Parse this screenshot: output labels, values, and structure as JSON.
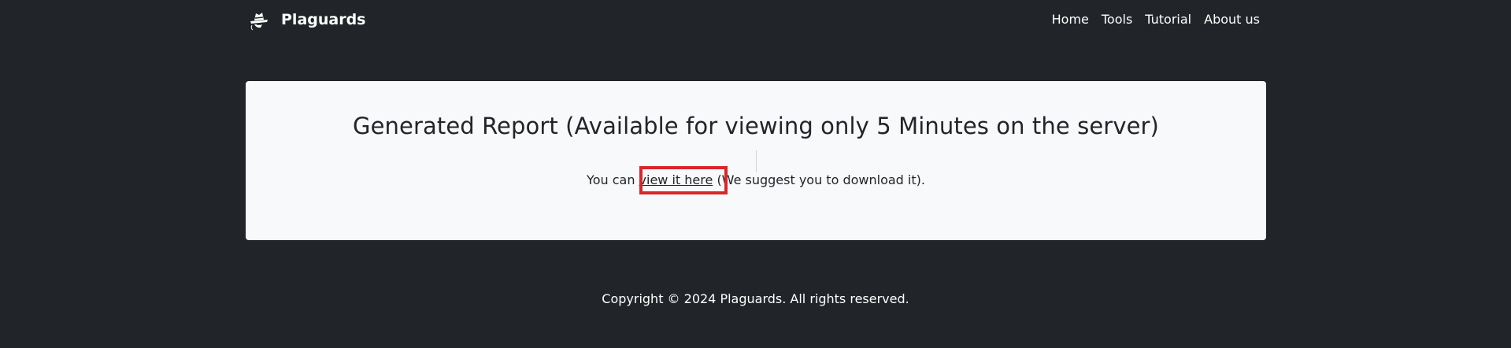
{
  "navbar": {
    "brand_name": "Plaguards",
    "logo_icon": "spy-hat-icon",
    "links": [
      "Home",
      "Tools",
      "Tutorial",
      "About us"
    ]
  },
  "card": {
    "title": "Generated Report (Available for viewing only 5 Minutes on the server)",
    "text_before": "You can",
    "link_text": "view it here",
    "text_after": "(We suggest you to download it)."
  },
  "footer": {
    "copyright": "Copyright © 2024 Plaguards. All rights reserved."
  },
  "colors": {
    "background": "#212529",
    "card": "#f8f9fa",
    "highlight": "#d9262b"
  }
}
